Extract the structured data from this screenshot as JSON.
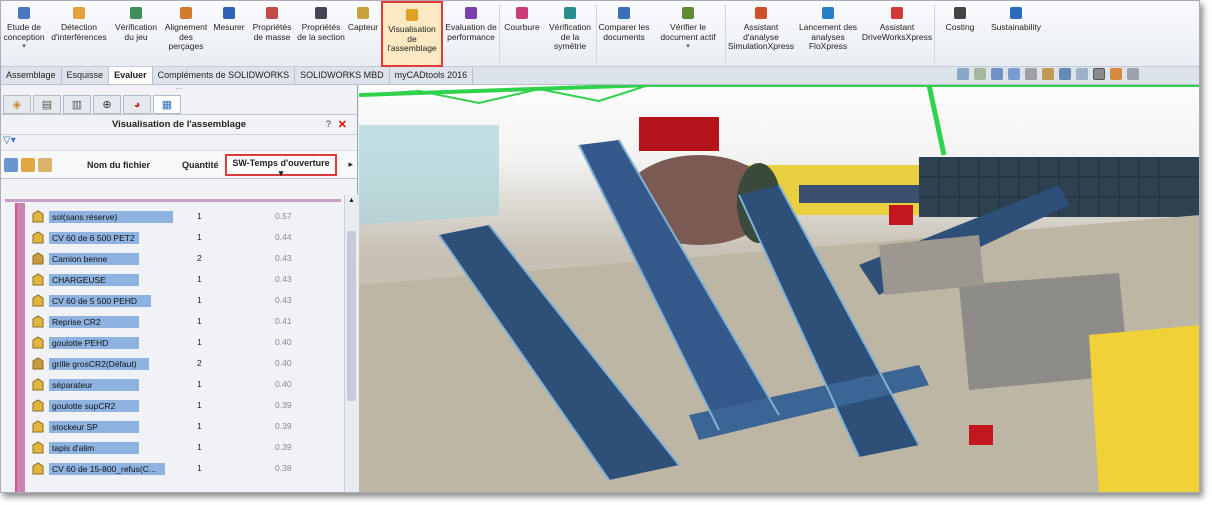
{
  "ribbon": {
    "buttons": [
      {
        "id": "etude",
        "label": "Etude de conception",
        "icon": "design-study-icon",
        "has_arrow": true,
        "width": 46
      },
      {
        "id": "detection",
        "label": "Détection d'interférences",
        "icon": "interference-icon",
        "width": 64
      },
      {
        "id": "verif-jeu",
        "label": "Vérification du jeu",
        "icon": "clearance-icon",
        "width": 50
      },
      {
        "id": "alignement",
        "label": "Alignement des perçages",
        "icon": "hole-alignment-icon",
        "width": 50
      },
      {
        "id": "mesurer",
        "label": "Mesurer",
        "icon": "measure-icon",
        "width": 36
      },
      {
        "id": "proprietes-masse",
        "label": "Propriétés de masse",
        "icon": "mass-properties-icon",
        "width": 50
      },
      {
        "id": "proprietes-section",
        "label": "Propriétés de la section",
        "icon": "section-properties-icon",
        "width": 48
      },
      {
        "id": "capteur",
        "label": "Capteur",
        "icon": "sensor-icon",
        "width": 36
      },
      {
        "id": "visualisation",
        "label": "Visualisation de l'assemblage",
        "icon": "assembly-visualization-icon",
        "selected": true,
        "width": 62
      },
      {
        "id": "evaluation",
        "label": "Evaluation de performance",
        "icon": "performance-icon",
        "width": 56
      },
      {
        "id": "courbure",
        "label": "Courbure",
        "icon": "curvature-icon",
        "width": 44
      },
      {
        "id": "verif-symetrie",
        "label": "Vérification de la symétrie",
        "icon": "symmetry-icon",
        "width": 52
      },
      {
        "id": "comparer",
        "label": "Comparer les documents",
        "icon": "compare-icon",
        "width": 54
      },
      {
        "id": "verifier-doc",
        "label": "Vérifier le document actif",
        "icon": "check-document-icon",
        "has_arrow": true,
        "width": 74
      },
      {
        "id": "simulationxpress",
        "label": "Assistant d'analyse SimulationXpress",
        "icon": "simulationxpress-icon",
        "width": 70
      },
      {
        "id": "floxpress",
        "label": "Lancement des analyses FloXpress",
        "icon": "floxpress-icon",
        "width": 64
      },
      {
        "id": "driveworks",
        "label": "Assistant DriveWorksXpress",
        "icon": "driveworks-icon",
        "width": 74
      },
      {
        "id": "costing",
        "label": "Costing",
        "icon": "costing-icon",
        "width": 50
      },
      {
        "id": "sustainability",
        "label": "Sustainability",
        "icon": "sustainability-icon",
        "width": 62
      }
    ]
  },
  "tabs": [
    "Assemblage",
    "Esquisse",
    "Evaluer",
    "Compléments de SOLIDWORKS",
    "SOLIDWORKS MBD",
    "myCADtools 2016"
  ],
  "active_tab": "Evaluer",
  "panel": {
    "title": "Visualisation de l'assemblage",
    "help": "?",
    "close": "✕",
    "columns": {
      "name": "Nom du fichier",
      "qty": "Quantité",
      "time": "SW-Temps d'ouverture"
    },
    "rows": [
      {
        "name": "sol(sans réserve)",
        "qty": "1",
        "time": "0.57",
        "icon": "part-icon"
      },
      {
        "name": "CV 60 de 6 500 PET2",
        "qty": "1",
        "time": "0.44",
        "icon": "part-icon"
      },
      {
        "name": "Camion benne",
        "qty": "2",
        "time": "0.43",
        "icon": "assembly-icon"
      },
      {
        "name": "CHARGEUSE",
        "qty": "1",
        "time": "0.43",
        "icon": "part-icon"
      },
      {
        "name": "CV 60 de 5 500 PEHD",
        "qty": "1",
        "time": "0.43",
        "icon": "part-icon"
      },
      {
        "name": "Reprise CR2",
        "qty": "1",
        "time": "0.41",
        "icon": "part-icon"
      },
      {
        "name": "goulotte PEHD",
        "qty": "1",
        "time": "0.40",
        "icon": "part-icon"
      },
      {
        "name": "grille grosCR2(Défaut)",
        "qty": "2",
        "time": "0.40",
        "icon": "assembly-icon"
      },
      {
        "name": "séparateur",
        "qty": "1",
        "time": "0.40",
        "icon": "part-icon"
      },
      {
        "name": "goulotte supCR2",
        "qty": "1",
        "time": "0.39",
        "icon": "part-icon"
      },
      {
        "name": "stockeur SP",
        "qty": "1",
        "time": "0.39",
        "icon": "part-icon"
      },
      {
        "name": "tapis d'alim",
        "qty": "1",
        "time": "0.39",
        "icon": "part-icon"
      },
      {
        "name": "CV 60 de 15-800_refus(C...",
        "qty": "1",
        "time": "0.38",
        "icon": "part-icon"
      }
    ]
  },
  "colors": {
    "highlight_red": "#e03a3a",
    "row_bar_blue": "#8fb3e0",
    "frame_green": "#2fd24a",
    "conveyor_blue": "#2e4f78",
    "wall_yellow": "#f0d238"
  }
}
